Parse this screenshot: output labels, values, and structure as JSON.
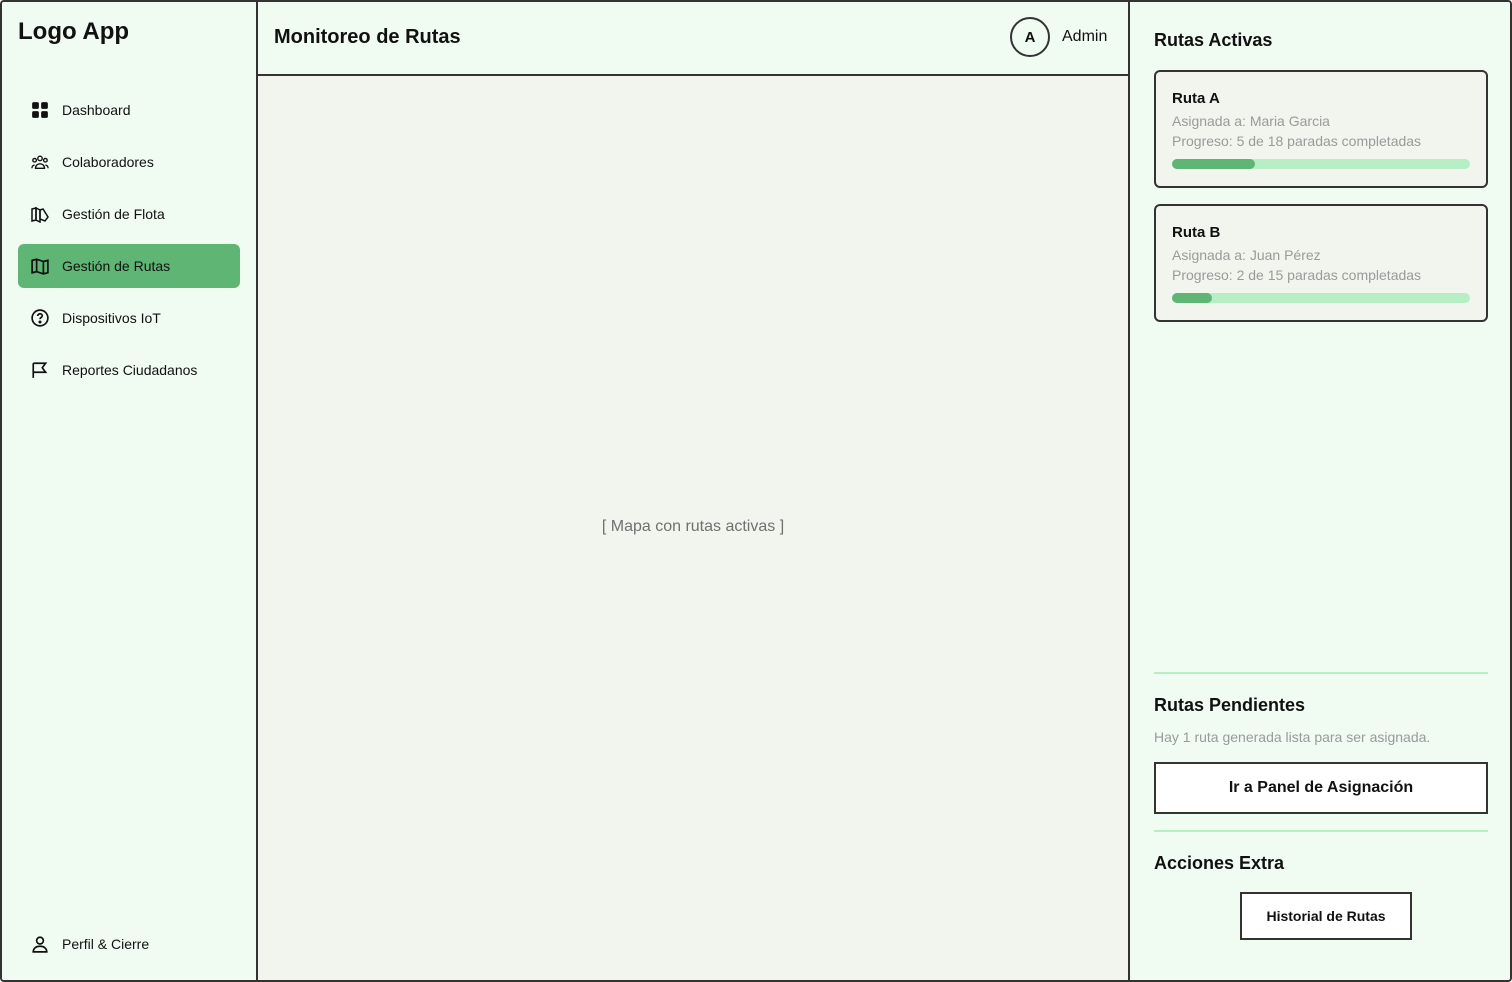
{
  "app": {
    "logo": "Logo App"
  },
  "sidebar": {
    "items": [
      {
        "label": "Dashboard",
        "icon": "grid-icon"
      },
      {
        "label": "Colaboradores",
        "icon": "users-icon"
      },
      {
        "label": "Gestión de Flota",
        "icon": "fleet-icon"
      },
      {
        "label": "Gestión de Rutas",
        "icon": "map-icon",
        "active": true
      },
      {
        "label": "Dispositivos IoT",
        "icon": "question-circle-icon"
      },
      {
        "label": "Reportes Ciudadanos",
        "icon": "flag-icon"
      }
    ],
    "profile_label": "Perfil & Cierre"
  },
  "header": {
    "title": "Monitoreo de Rutas",
    "avatar_initial": "A",
    "user_name": "Admin"
  },
  "map": {
    "placeholder": "[ Mapa con rutas activas ]"
  },
  "right_panel": {
    "active_title": "Rutas Activas",
    "routes": [
      {
        "name": "Ruta A",
        "assigned": "Asignada a: Maria Garcia",
        "progress_text": "Progreso: 5 de 18 paradas completadas",
        "progress": 0.278
      },
      {
        "name": "Ruta B",
        "assigned": "Asignada a: Juan Pérez",
        "progress_text": "Progreso: 2 de 15 paradas completadas",
        "progress": 0.133
      }
    ],
    "pending_title": "Rutas Pendientes",
    "pending_text": "Hay 1 ruta generada lista para ser asignada.",
    "assign_button": "Ir a Panel de Asignación",
    "extra_title": "Acciones Extra",
    "history_button": "Historial de Rutas"
  },
  "colors": {
    "accent": "#5fb574",
    "progress_track": "#b6efc4",
    "background": "#f0fbf2",
    "map_background": "#f2f5ee"
  }
}
